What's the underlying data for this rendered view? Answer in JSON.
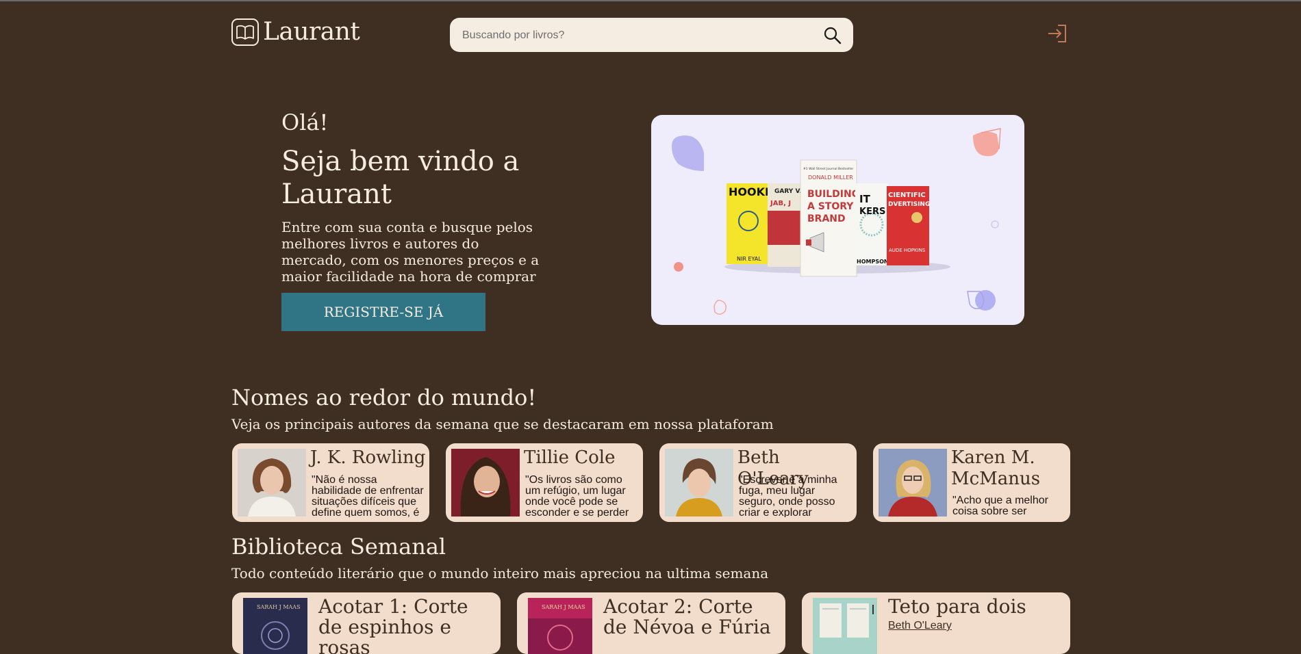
{
  "header": {
    "brand": "Laurant",
    "search_placeholder": "Buscando por livros?"
  },
  "hero": {
    "greeting": "Olá!",
    "title": "Seja bem vindo a Laurant",
    "description": "Entre com sua conta e busque pelos melhores livros e autores do mercado, com os menores preços e a maior facilidade na hora de comprar",
    "cta_label": "REGISTRE-SE JÁ",
    "books": [
      {
        "line1": "HOOKE",
        "line2": "NIR EYAL"
      },
      {
        "line1": "JAB, J",
        "line2": "GARY VA"
      },
      {
        "top": "#1 Wall Street Journal Bestseller",
        "author": "DONALD MILLER",
        "title1": "BUILDING",
        "title2": "A STORY",
        "title3": "BRAND"
      },
      {
        "line1": "IT",
        "line2": "KERS",
        "line3": "HOMPSON"
      },
      {
        "line1": "CIENTIFIC",
        "line2": "DVERTISING",
        "line3": "AUDE HOPKINS"
      }
    ]
  },
  "authors_section": {
    "title": "Nomes ao redor do mundo!",
    "subtitle": "Veja os principais autores da semana que se destacaram em nossa plataforam",
    "authors": [
      {
        "name": "J. K. Rowling",
        "quote": "\"Não é nossa habilidade de enfrentar situações difíceis que define quem somos, é"
      },
      {
        "name": "Tillie Cole",
        "quote": "\"Os livros são como um refúgio, um lugar onde você pode se esconder e se perder"
      },
      {
        "name": "Beth O'Leary",
        "quote": "\"Escrever é a minha fuga, meu lugar seguro, onde posso criar e explorar"
      },
      {
        "name": "Karen M. McManus",
        "quote": "\"Acho que a melhor coisa sobre ser"
      }
    ]
  },
  "library_section": {
    "title": "Biblioteca Semanal",
    "subtitle": "Todo conteúdo literário que o mundo inteiro mais apreciou na ultima semana",
    "books": [
      {
        "title": "Acotar 1: Corte de espinhos e rosas",
        "author": "",
        "cover_author": "SARAH J MAAS"
      },
      {
        "title": "Acotar 2: Corte de Névoa e Fúria",
        "author": "",
        "cover_author": "SARAH J MAAS"
      },
      {
        "title": "Teto para dois",
        "author": "Beth O'Leary"
      }
    ]
  }
}
